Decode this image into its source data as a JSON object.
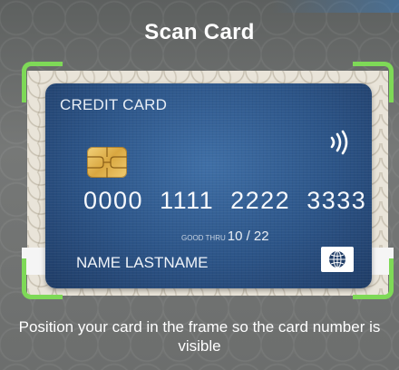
{
  "header": {
    "title": "Scan Card"
  },
  "card": {
    "label": "CREDIT CARD",
    "number": "0000  1111  2222  3333",
    "expiry_prefix": "GOOD THRU",
    "expiry": "10 / 22",
    "holder": "NAME LASTNAME",
    "contactless_icon": "contactless-icon",
    "network_icon": "globe-icon"
  },
  "footer": {
    "instructions": "Position your card in the frame so the card number is visible"
  },
  "colors": {
    "frame_corner": "#7ed957",
    "card_blue": "#2c5487"
  }
}
